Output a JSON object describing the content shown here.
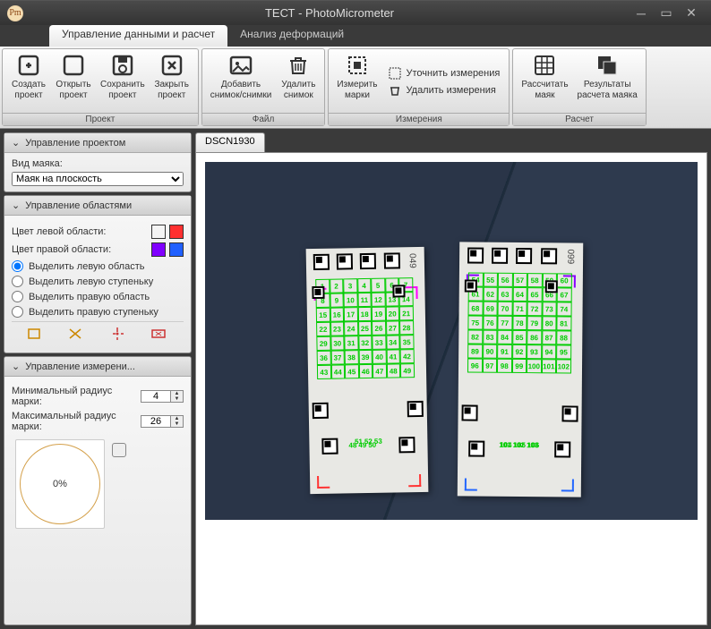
{
  "window": {
    "title": "ТЕСТ - PhotoMicrometer"
  },
  "tabs": {
    "data": "Управление данными и расчет",
    "deform": "Анализ деформаций"
  },
  "ribbon": {
    "groups": {
      "project": "Проект",
      "file": "Файл",
      "measure": "Измерения",
      "calc": "Расчет"
    },
    "create": "Создать\nпроект",
    "open": "Открыть\nпроект",
    "save": "Сохранить\nпроект",
    "close": "Закрыть\nпроект",
    "add_img": "Добавить\nснимок/снимки",
    "del_img": "Удалить\nснимок",
    "measure_marks": "Измерить\nмарки",
    "refine": "Уточнить измерения",
    "del_meas": "Удалить измерения",
    "calc_beacon": "Рассчитать\nмаяк",
    "results": "Результаты\nрасчета маяка"
  },
  "side": {
    "proj_head": "Управление проектом",
    "beacon_label": "Вид маяка:",
    "beacon_value": "Маяк на плоскость",
    "areas_head": "Управление областями",
    "left_color": "Цвет левой области:",
    "right_color": "Цвет правой области:",
    "sel_left_area": "Выделить левую область",
    "sel_left_step": "Выделить левую ступеньку",
    "sel_right_area": "Выделить правую область",
    "sel_right_step": "Выделить правую ступеньку",
    "meas_head": "Управление измерени...",
    "min_r": "Минимальный радиус марки:",
    "min_r_val": "4",
    "max_r": "Максимальный радиус марки:",
    "max_r_val": "26",
    "progress": "0%"
  },
  "colors": {
    "left1": "#ff00ff",
    "left2": "#ff3030",
    "right1": "#8000ff",
    "right2": "#2060ff"
  },
  "doc": {
    "tab": "DSCN1930",
    "left_serial": "049",
    "right_serial": "099"
  }
}
